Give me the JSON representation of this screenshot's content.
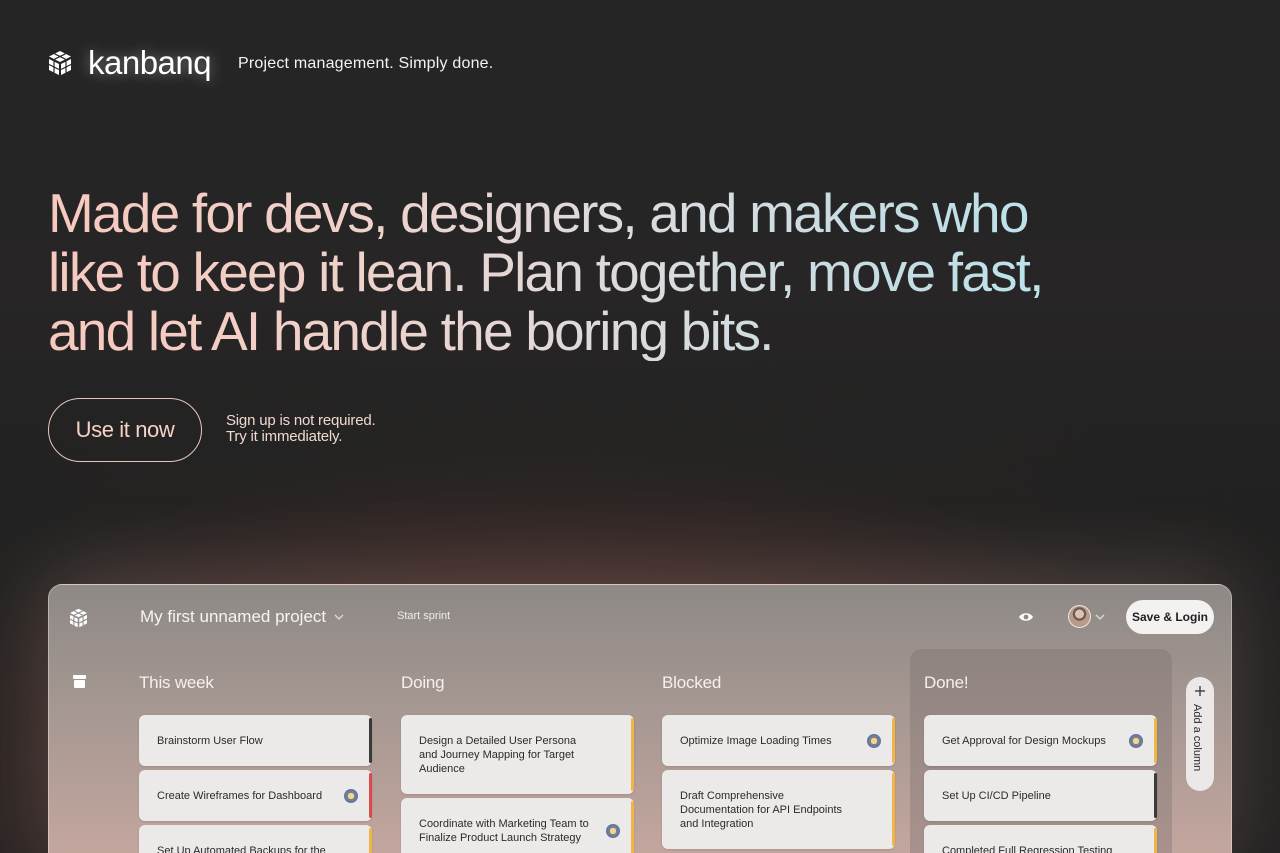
{
  "header": {
    "brand": "kanbanq",
    "tagline": "Project management. Simply done."
  },
  "hero": {
    "line1": "Made for devs, designers, and makers who",
    "line2": "like to keep it lean. Plan together, move fast,",
    "line3": "and let AI handle the boring bits."
  },
  "cta": {
    "button": "Use it now",
    "note1": "Sign up is not required.",
    "note2": "Try it immediately."
  },
  "app": {
    "project_title": "My first unnamed project",
    "start_sprint": "Start sprint",
    "save_login": "Save & Login",
    "add_column": "Add a column",
    "columns": [
      {
        "title": "This week",
        "cards": [
          {
            "title": "Brainstorm User Flow",
            "accent": "#3a3a3a",
            "assigned": false
          },
          {
            "title": "Create Wireframes for Dashboard",
            "accent": "#d94a4a",
            "assigned": true
          },
          {
            "title": "Set Up Automated Backups for the",
            "accent": "#f0b545",
            "assigned": false
          }
        ]
      },
      {
        "title": "Doing",
        "cards": [
          {
            "title": "Design a Detailed User Persona and Journey Mapping for Target Audience",
            "accent": "#f0b545",
            "assigned": false
          },
          {
            "title": "Coordinate with Marketing Team to Finalize Product Launch Strategy",
            "accent": "#f0b545",
            "assigned": true
          }
        ]
      },
      {
        "title": "Blocked",
        "cards": [
          {
            "title": "Optimize Image Loading Times",
            "accent": "#f0b545",
            "assigned": true
          },
          {
            "title": "Draft Comprehensive Documentation for API Endpoints and Integration",
            "accent": "#f0b545",
            "assigned": false
          }
        ]
      },
      {
        "title": "Done!",
        "cards": [
          {
            "title": "Get Approval for Design Mockups",
            "accent": "#f0b545",
            "assigned": true
          },
          {
            "title": "Set Up CI/CD Pipeline",
            "accent": "#3a3a3a",
            "assigned": false
          },
          {
            "title": "Completed Full Regression Testing",
            "accent": "#f0b545",
            "assigned": false
          }
        ]
      }
    ]
  }
}
